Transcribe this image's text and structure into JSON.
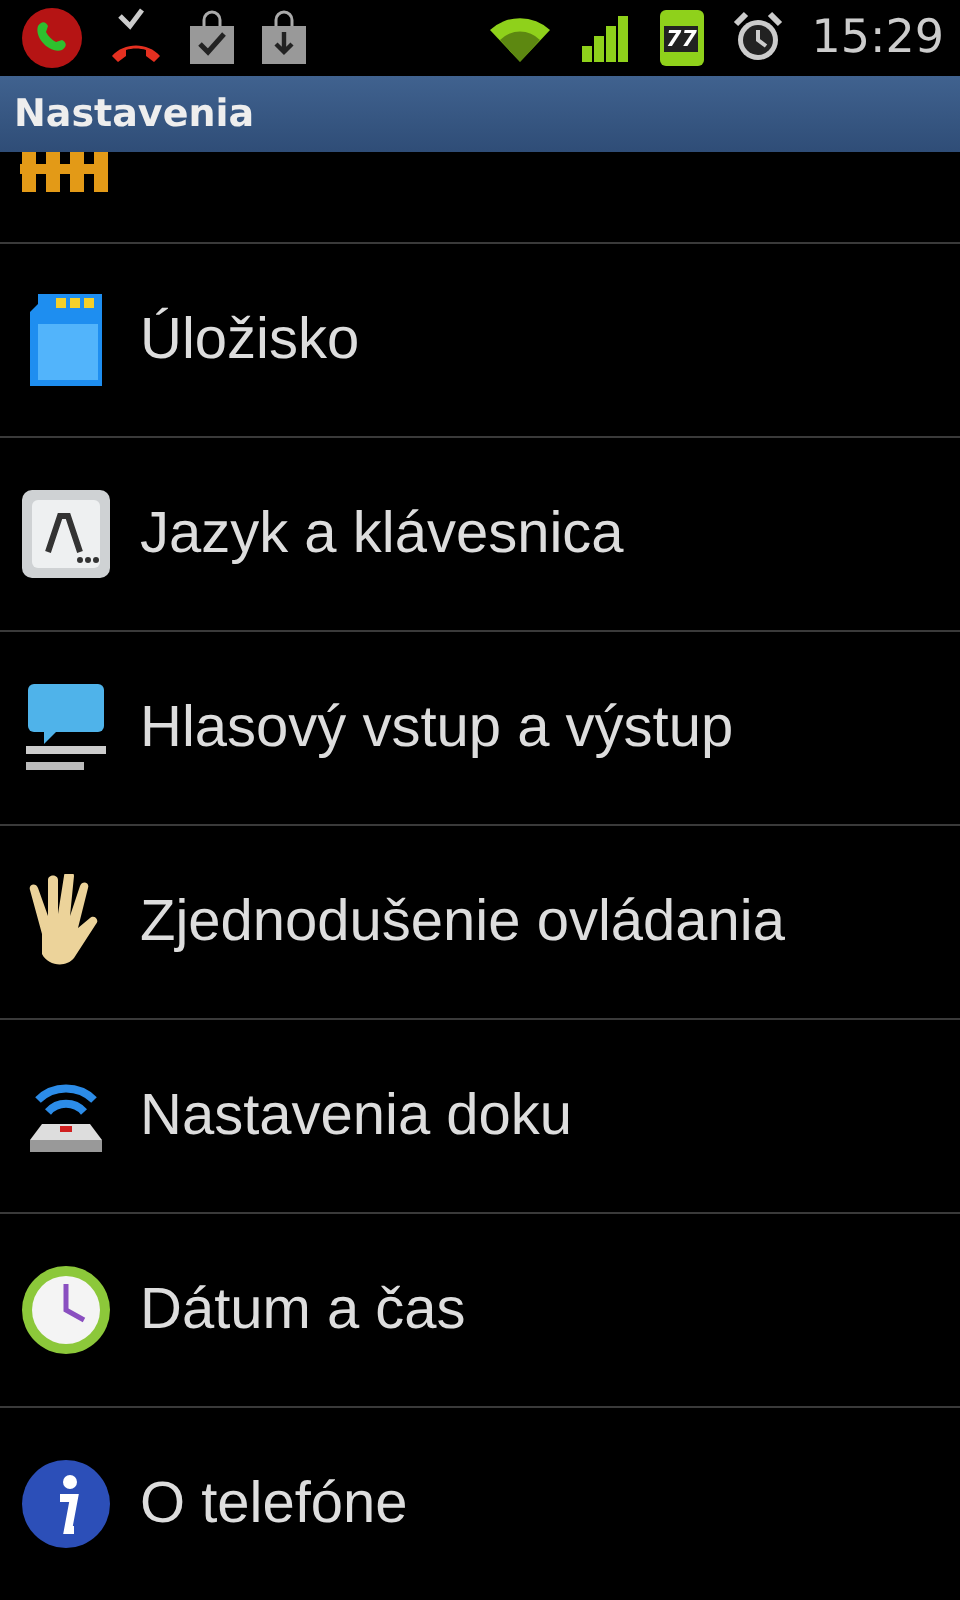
{
  "status_bar": {
    "battery_level": "77",
    "time": "15:29"
  },
  "window": {
    "title": "Nastavenia"
  },
  "partial_item": {
    "kind": "privacy"
  },
  "settings": [
    {
      "label": "Úložisko",
      "kind": "storage"
    },
    {
      "label": "Jazyk a klávesnica",
      "kind": "keyboard"
    },
    {
      "label": "Hlasový vstup a výstup",
      "kind": "voice"
    },
    {
      "label": "Zjednodušenie ovládania",
      "kind": "accessibility"
    },
    {
      "label": "Nastavenia doku",
      "kind": "dock"
    },
    {
      "label": "Dátum a čas",
      "kind": "clock"
    },
    {
      "label": "O telefóne",
      "kind": "info"
    }
  ]
}
